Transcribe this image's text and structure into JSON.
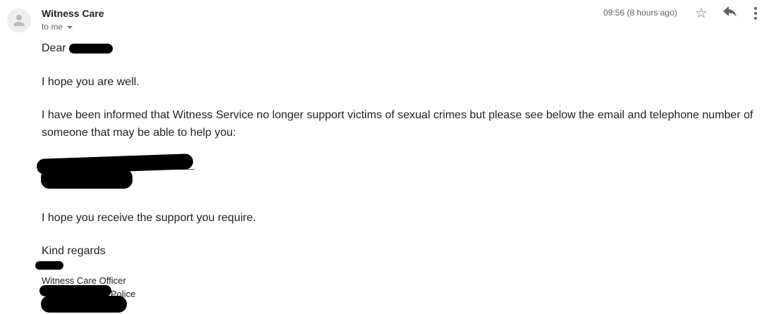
{
  "header": {
    "sender": "Witness Care",
    "recipient_label": "to me",
    "timestamp": "09:56 (8 hours ago)",
    "icons": [
      "person-avatar-icon",
      "star-icon",
      "reply-icon",
      "more-vert-icon"
    ]
  },
  "body": {
    "greeting": "Dear",
    "line1": "I hope you are well.",
    "para_line1": "I have been informed that Witness Service no longer support victims of sexual crimes but please see below the email and telephone number of",
    "para_line2": "someone that may be able to help you:",
    "closing_line": "I hope you receive the support you require.",
    "sign_off": "Kind regards",
    "signature_title": "Witness Care Officer",
    "signature_org_suffix": "Police"
  }
}
